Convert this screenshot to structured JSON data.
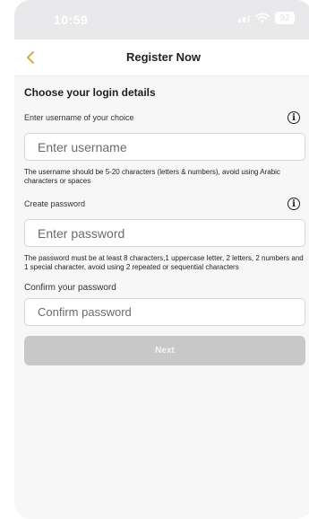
{
  "status_bar": {
    "time": "10:59",
    "battery": "92"
  },
  "header": {
    "title": "Register Now",
    "accent_color": "#d6a233"
  },
  "form": {
    "section_title": "Choose your login details",
    "username": {
      "label": "Enter username of your choice",
      "placeholder": "Enter username",
      "hint": "The username should be 5-20 characters (letters & numbers), avoid using Arabic characters or spaces"
    },
    "password": {
      "label": "Create password",
      "placeholder": "Enter password",
      "hint": "The password must be at least 8 characters,1 uppercase letter, 2 letters, 2 numbers and 1 special character, avoid using 2 repeated or sequential characters"
    },
    "confirm": {
      "label": "Confirm your password",
      "placeholder": "Confirm password"
    },
    "next_label": "Next"
  },
  "icons": {
    "back": "chevron-left-icon",
    "info": "info-icon",
    "signal": "signal-icon",
    "wifi": "wifi-icon",
    "battery": "battery-icon"
  }
}
